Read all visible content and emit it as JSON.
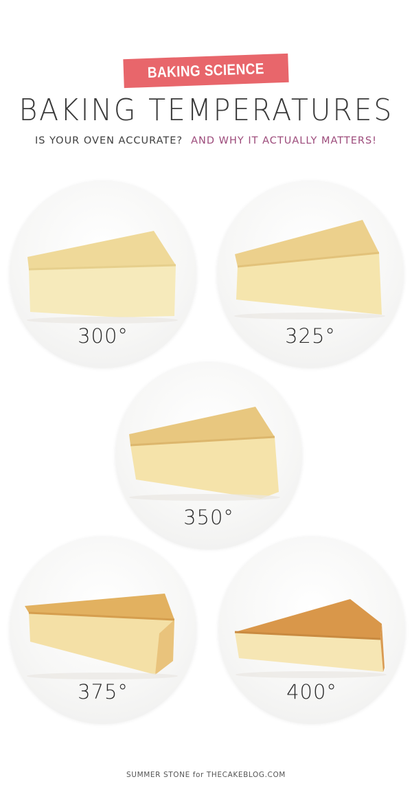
{
  "header": {
    "badge_label": "BAKING SCIENCE",
    "title": "BAKING TEMPERATURES",
    "subtitle_part1": "IS YOUR OVEN ACCURATE?",
    "subtitle_part2": "AND WHY IT ACTUALLY MATTERS!"
  },
  "colors": {
    "badge_background": "#e8666b",
    "subtitle_accent": "#9c4a7a",
    "title_text": "#3a3a3a"
  },
  "samples": [
    {
      "temperature": "300°",
      "crust_color": "#efd999",
      "crumb_color": "#f6eabb"
    },
    {
      "temperature": "325°",
      "crust_color": "#ecd08c",
      "crumb_color": "#f5e5ad"
    },
    {
      "temperature": "350°",
      "crust_color": "#e8c77f",
      "crumb_color": "#f5e3aa"
    },
    {
      "temperature": "375°",
      "crust_color": "#e2b160",
      "crumb_color": "#f4e0a6"
    },
    {
      "temperature": "400°",
      "crust_color": "#d9974a",
      "crumb_color": "#f6e6b4"
    }
  ],
  "footer": {
    "credit": "SUMMER STONE for THECAKEBLOG.COM"
  }
}
